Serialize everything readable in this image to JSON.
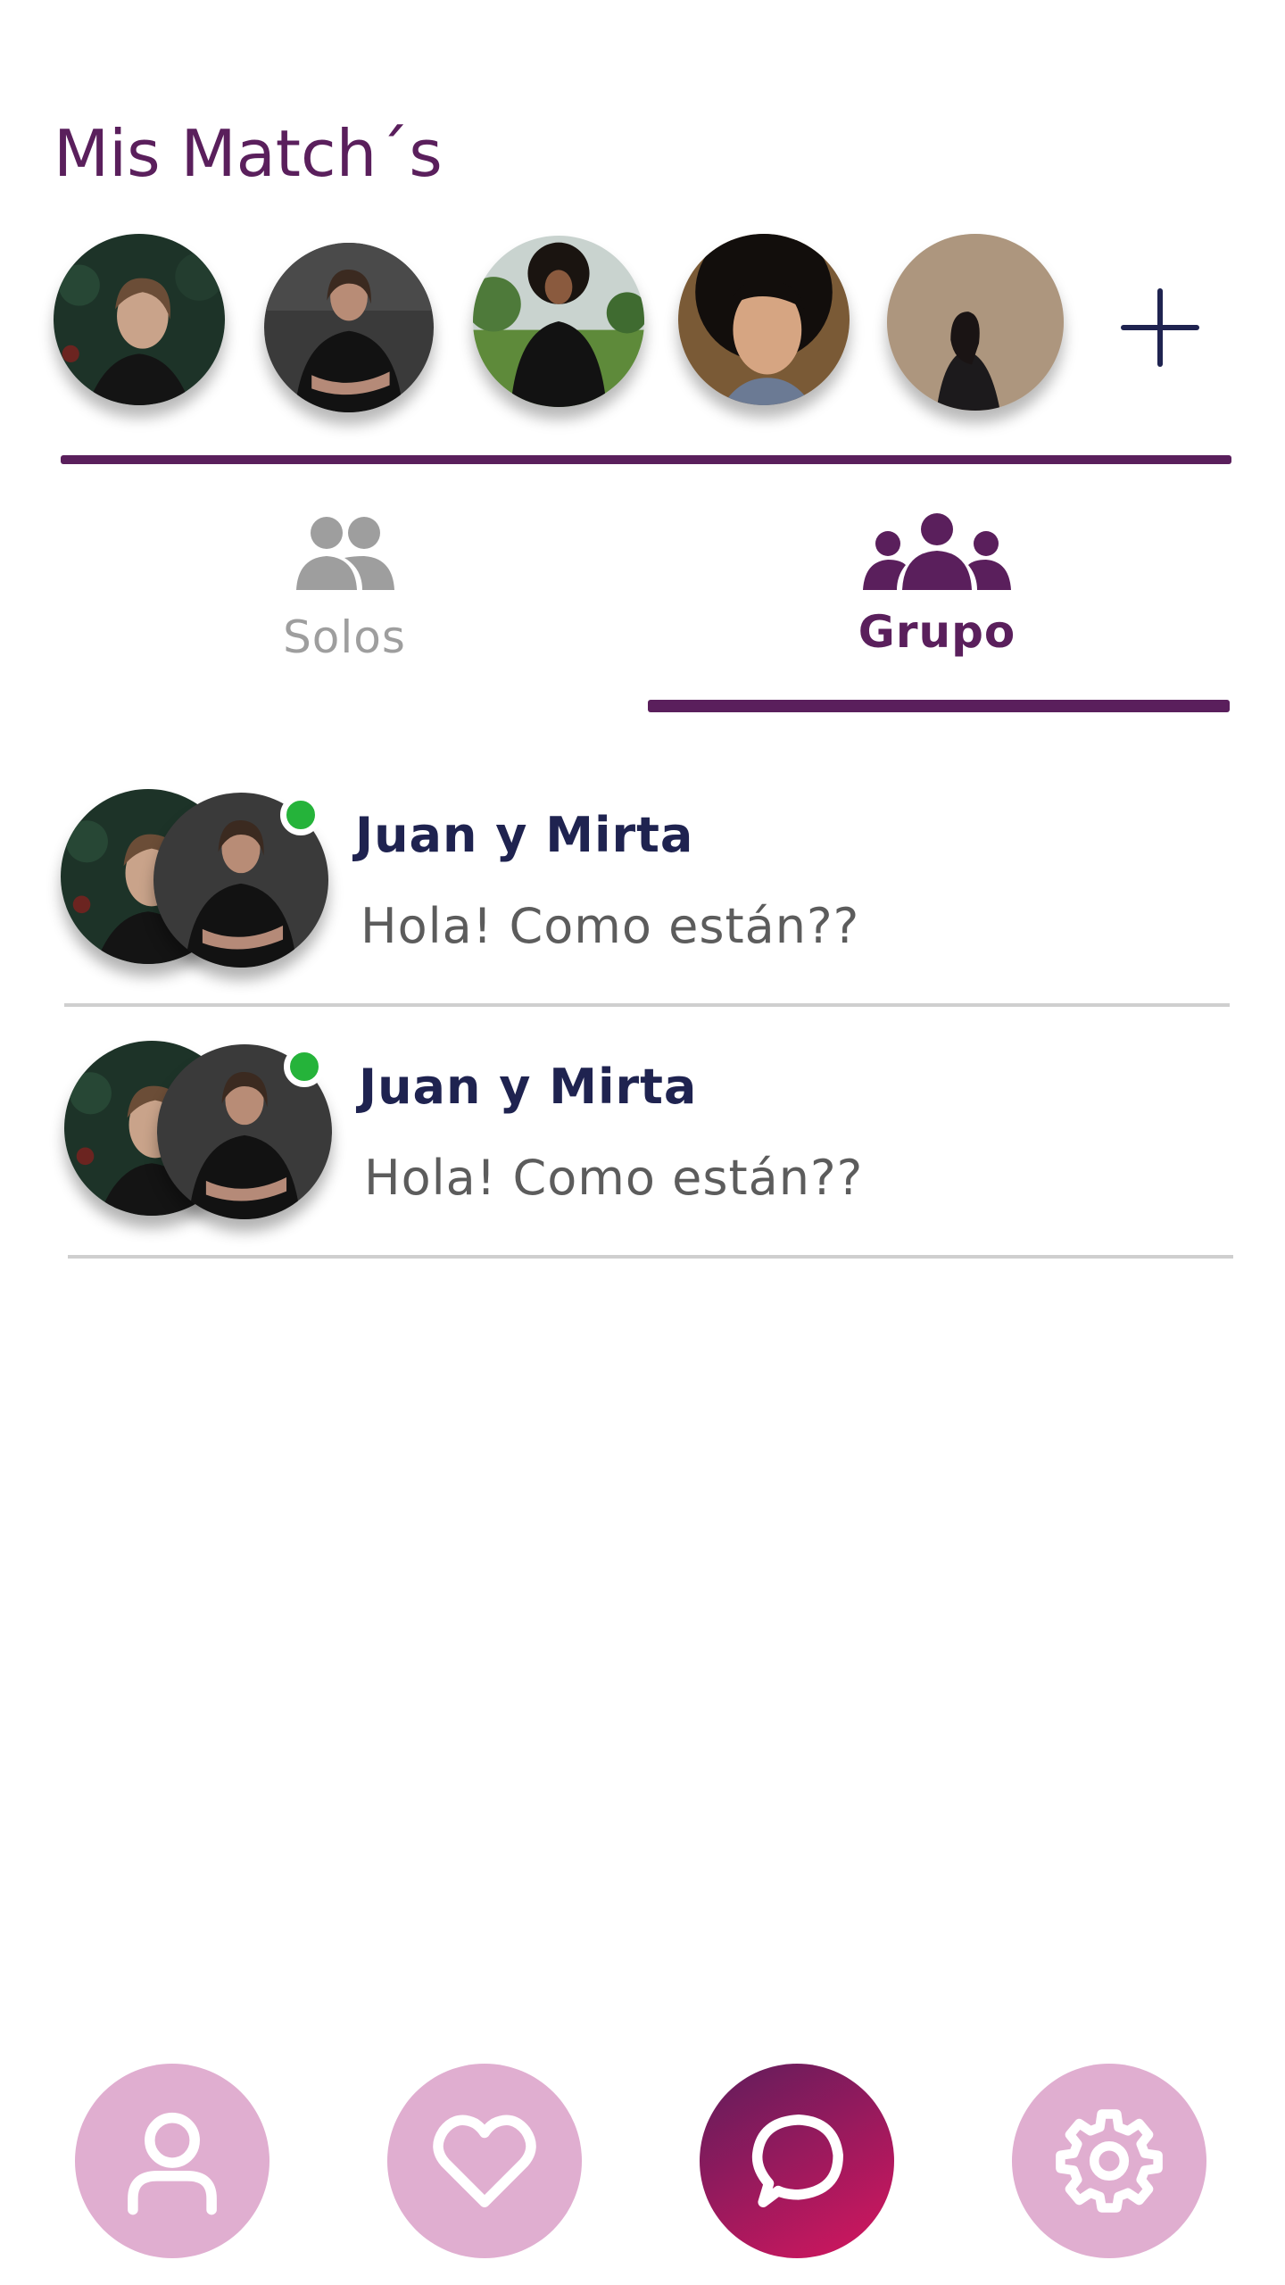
{
  "header": {
    "title": "Mis Match´s"
  },
  "matches": {
    "avatars": [
      {
        "name": "match-avatar-1"
      },
      {
        "name": "match-avatar-2"
      },
      {
        "name": "match-avatar-3"
      },
      {
        "name": "match-avatar-4"
      },
      {
        "name": "match-avatar-5"
      }
    ],
    "add_icon": "plus-icon"
  },
  "tabs": {
    "solos": {
      "label": "Solos",
      "icon": "two-people-icon",
      "active": false
    },
    "grupo": {
      "label": "Grupo",
      "icon": "group-icon",
      "active": true
    }
  },
  "chats": [
    {
      "name": "Juan y Mirta",
      "message": "Hola! Como están??",
      "online": true
    },
    {
      "name": "Juan y Mirta",
      "message": "Hola! Como están??",
      "online": true
    }
  ],
  "nav": [
    {
      "icon": "user-icon",
      "active": false
    },
    {
      "icon": "heart-icon",
      "active": false
    },
    {
      "icon": "chat-bubble-icon",
      "active": true
    },
    {
      "icon": "gear-icon",
      "active": false
    }
  ],
  "colors": {
    "brand": "#5a1f5c",
    "name_text": "#1f2350",
    "online": "#25b33a",
    "nav_inactive": "#e0aed0",
    "nav_active_start": "#5e1d5c",
    "nav_active_end": "#d6165e"
  }
}
